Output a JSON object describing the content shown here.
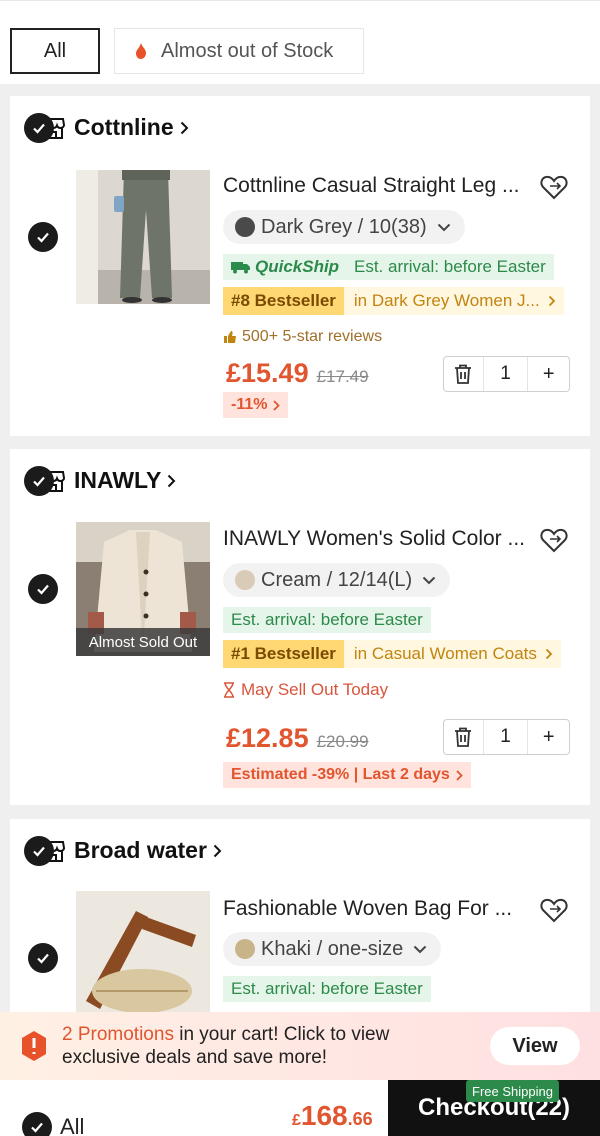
{
  "filters": {
    "all": "All",
    "stock": "Almost out of Stock"
  },
  "stores": [
    {
      "name": "Cottnline",
      "product": {
        "title": "Cottnline Casual Straight Leg ...",
        "variant": "Dark Grey / 10(38)",
        "quickship": "QuickShip",
        "arrival": "Est. arrival: before Easter",
        "rank": "#8 Bestseller",
        "category": "in Dark Grey Women J...",
        "reviews": "500+ 5-star reviews",
        "price": "£15.49",
        "old_price": "£17.49",
        "qty": "1",
        "discount": "-11%"
      }
    },
    {
      "name": "INAWLY",
      "product": {
        "title": "INAWLY Women's Solid Color ...",
        "variant": "Cream / 12/14(L)",
        "badge": "Almost Sold Out",
        "arrival": "Est. arrival: before Easter",
        "rank": "#1 Bestseller",
        "category": "in Casual Women Coats",
        "warning": "May Sell Out Today",
        "price": "£12.85",
        "old_price": "£20.99",
        "qty": "1",
        "discount": "Estimated -39% | Last 2 days"
      }
    },
    {
      "name": "Broad water",
      "product": {
        "title": "Fashionable Woven Bag For ...",
        "variant": "Khaki / one-size",
        "arrival": "Est. arrival: before Easter"
      }
    }
  ],
  "promo": {
    "highlight": "2 Promotions",
    "text": " in your cart! Click to view exclusive deals and save more!",
    "button": "View"
  },
  "bottom": {
    "all_label": "All",
    "currency": "£",
    "total_int": "168",
    "total_dec": ".66",
    "checkout": "Checkout(22)",
    "free_shipping": "Free Shipping"
  },
  "colors": {
    "accent": "#e1552f",
    "green": "#2c8a4a",
    "gold": "#c28410"
  }
}
